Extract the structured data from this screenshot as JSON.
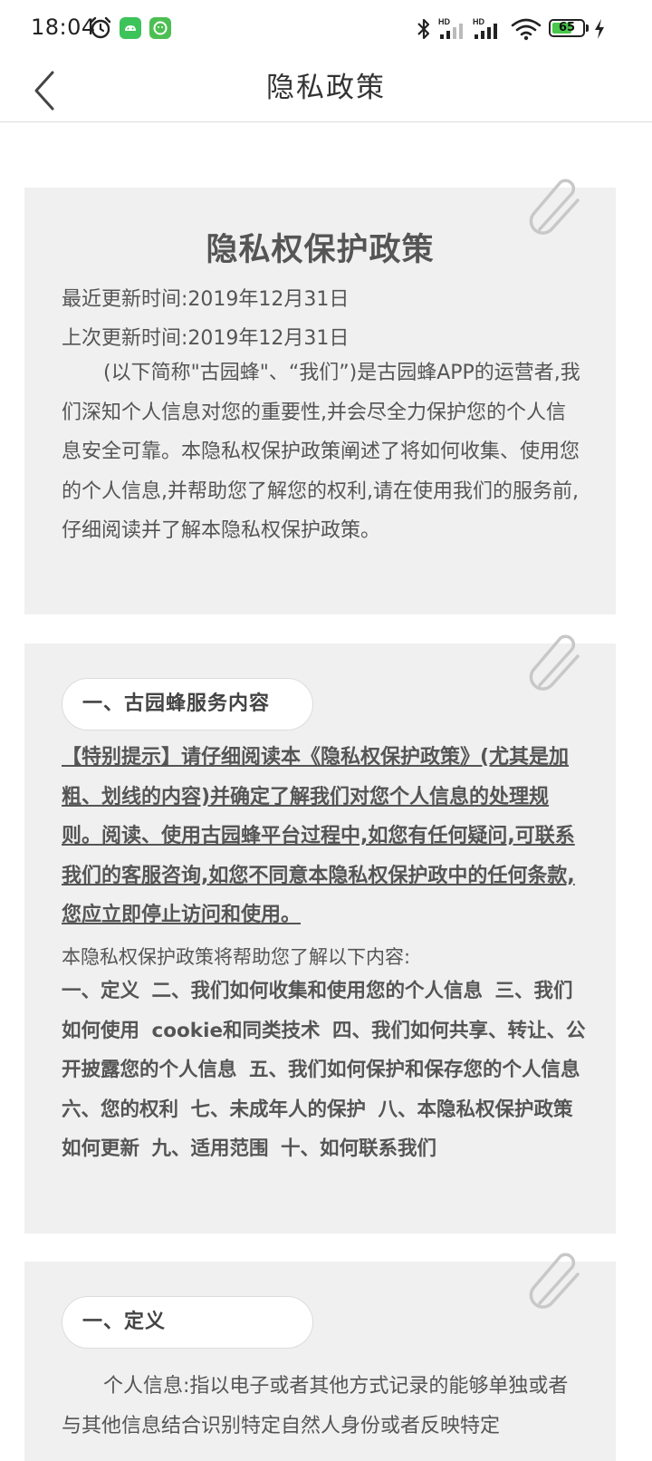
{
  "status_bar": {
    "time": "18:04",
    "battery_level": "65",
    "battery_fraction": 0.65,
    "icons": [
      "alarm-icon",
      "android-app-icon",
      "robot-app-icon",
      "bluetooth-icon",
      "hd-signal-icon",
      "hd-signal-icon",
      "wifi-icon",
      "battery-icon",
      "charging-icon"
    ]
  },
  "header": {
    "title": "隐私政策",
    "back_icon": "chevron-left-icon"
  },
  "card1": {
    "title": "隐私权保护政策",
    "updated_recent": "最近更新时间:2019年12月31日",
    "updated_last": "上次更新时间:2019年12月31日",
    "intro_paragraph": "(以下简称\"古园蜂\"、“我们”)是古园蜂APP的运营者,我们深知个人信息对您的重要性,并会尽全力保护您的个人信息安全可靠。本隐私权保护政策阐述了将如何收集、使用您的个人信息,并帮助您了解您的权利,请在使用我们的服务前,仔细阅读并了解本隐私权保护政策。"
  },
  "card2": {
    "section_label": "一、古园蜂服务内容",
    "notice": "【特别提示】请仔细阅读本《隐私权保护政策》(尤其是加粗、划线的内容)并确定了解我们对您个人信息的处理规则。阅读、使用古园蜂平台过程中,如您有任何疑问,可联系我们的客服咨询,如您不同意本隐私权保护政中的任何条款,您应立即停止访问和使用。",
    "intro": "本隐私权保护政策将帮助您了解以下内容:",
    "toc": "一、定义 二、我们如何收集和使用您的个人信息 三、我们如何使用 cookie和同类技术 四、我们如何共享、转让、公开披露您的个人信息 五、我们如何保护和保存您的个人信息 六、您的权利 七、未成年人的保护 八、本隐私权保护政策如何更新 九、适用范围 十、如何联系我们"
  },
  "card3": {
    "section_label": "一、定义",
    "definition": "个人信息:指以电子或者其他方式记录的能够单独或者与其他信息结合识别特定自然人身份或者反映特定"
  },
  "colors": {
    "card_background": "#f0f0f0",
    "text": "#555555",
    "battery_green": "#48c84a"
  }
}
